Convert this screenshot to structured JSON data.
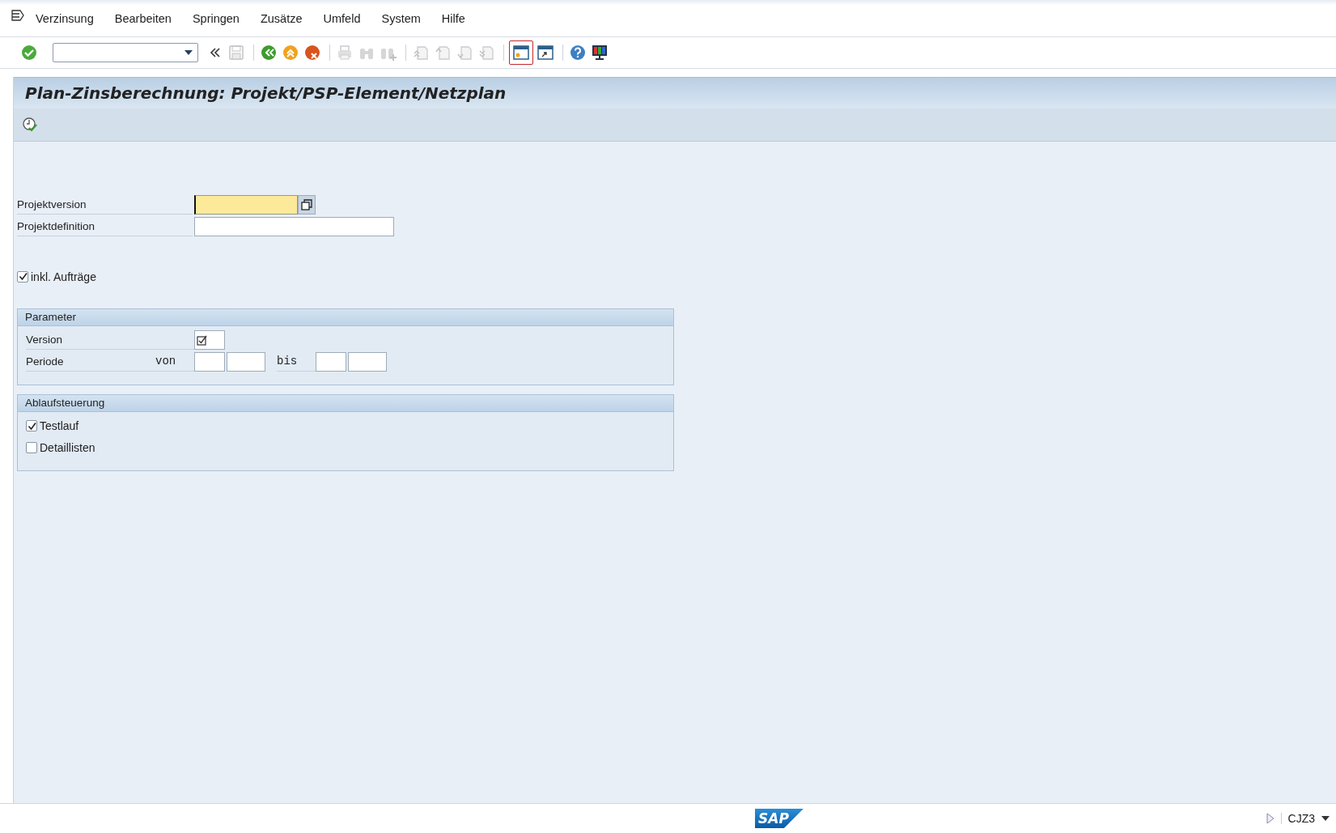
{
  "menu": [
    {
      "label": "Verzinsung"
    },
    {
      "label": "Bearbeiten"
    },
    {
      "label": "Springen"
    },
    {
      "label": "Zusätze"
    },
    {
      "label": "Umfeld"
    },
    {
      "label": "System"
    },
    {
      "label": "Hilfe"
    }
  ],
  "toolbar": {
    "buttons": [
      {
        "kind": "enter",
        "disabled": false
      },
      {
        "kind": "collapse",
        "disabled": false
      },
      {
        "kind": "save",
        "disabled": true
      },
      {
        "kind": "sep"
      },
      {
        "kind": "back",
        "disabled": false
      },
      {
        "kind": "exit",
        "disabled": false
      },
      {
        "kind": "cancel",
        "disabled": false
      },
      {
        "kind": "sep"
      },
      {
        "kind": "print",
        "disabled": true
      },
      {
        "kind": "find",
        "disabled": true
      },
      {
        "kind": "findnext",
        "disabled": true
      },
      {
        "kind": "sep"
      },
      {
        "kind": "first",
        "disabled": true
      },
      {
        "kind": "prev",
        "disabled": true
      },
      {
        "kind": "next",
        "disabled": true
      },
      {
        "kind": "last",
        "disabled": true
      },
      {
        "kind": "sep"
      },
      {
        "kind": "newsession",
        "disabled": false,
        "selected": true
      },
      {
        "kind": "shortcut",
        "disabled": false,
        "selected": false
      },
      {
        "kind": "sep"
      },
      {
        "kind": "help",
        "disabled": false
      },
      {
        "kind": "layout",
        "disabled": false
      }
    ]
  },
  "screen": {
    "title": "Plan-Zinsberechnung: Projekt/PSP-Element/Netzplan"
  },
  "fields": [
    {
      "label": "Projektversion",
      "focused": true,
      "match_button": true
    },
    {
      "label": "Projektdefinition",
      "focused": false,
      "match_button": false
    }
  ],
  "include_orders": {
    "label": "inkl. Aufträge",
    "checked": true
  },
  "parameter": {
    "title": "Parameter",
    "version": {
      "label": "Version",
      "checked": true
    },
    "period": {
      "label": "Periode",
      "from_label": "von",
      "to_label": "bis"
    }
  },
  "control": {
    "title": "Ablaufsteuerung",
    "options": [
      {
        "label": "Testlauf",
        "checked": true
      },
      {
        "label": "Detaillisten",
        "checked": false
      }
    ]
  },
  "status_bar": {
    "logo": "SAP",
    "transaction": "CJZ3"
  }
}
